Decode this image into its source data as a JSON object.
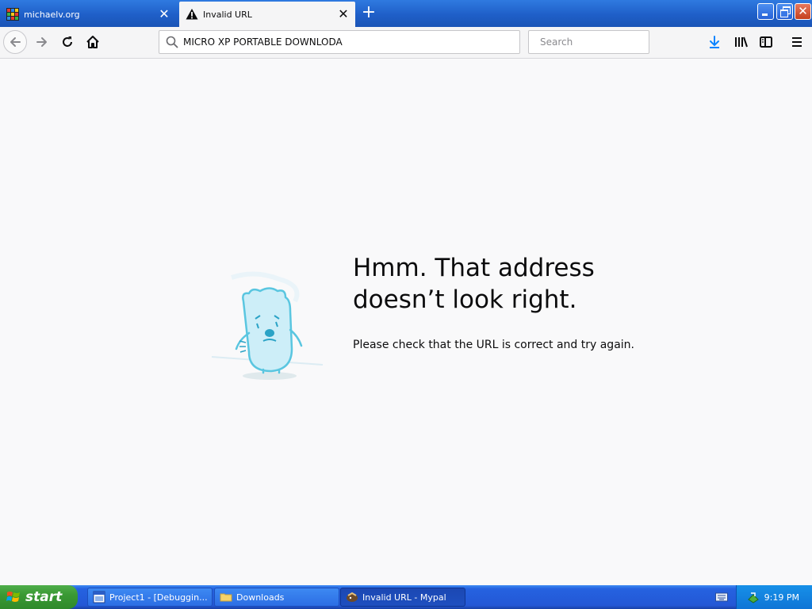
{
  "tabs": [
    {
      "title": "michaelv.org",
      "active": false
    },
    {
      "title": "Invalid URL",
      "active": true
    }
  ],
  "toolbar": {
    "url": "MICRO XP PORTABLE DOWNLODA",
    "search_placeholder": "Search"
  },
  "error": {
    "title": "Hmm. That address doesn’t look right.",
    "description": "Please check that the URL is correct and try again."
  },
  "taskbar": {
    "start_label": "start",
    "tasks": [
      {
        "label": "Project1 - [Debuggin..."
      },
      {
        "label": "Downloads"
      },
      {
        "label": "Invalid URL - Mypal"
      }
    ],
    "clock": "9:19 PM"
  },
  "colors": {
    "page_bg": "#f9f9fa",
    "accent": "#0a84ff",
    "xp_blue": "#2458d6",
    "start_green": "#3a9934"
  }
}
